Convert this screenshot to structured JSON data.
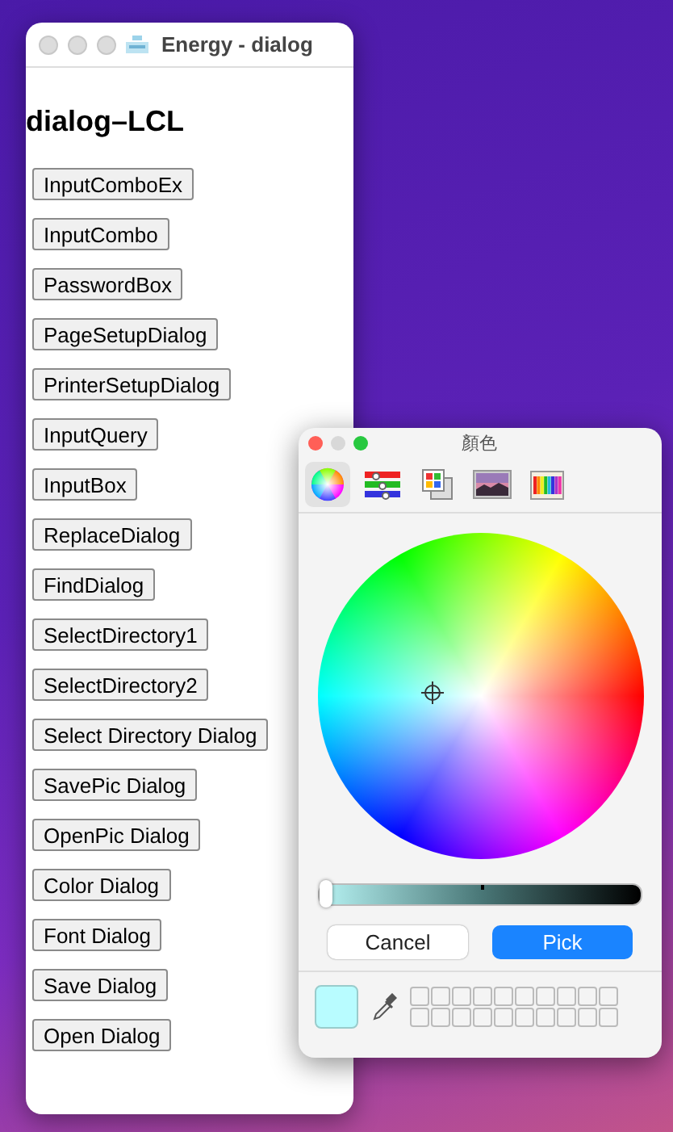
{
  "window": {
    "title": "Energy - dialog"
  },
  "heading": "dialog–LCL",
  "buttons": [
    "InputComboEx",
    "InputCombo",
    "PasswordBox",
    "PageSetupDialog",
    "PrinterSetupDialog",
    "InputQuery",
    "InputBox",
    "ReplaceDialog",
    "FindDialog",
    "SelectDirectory1",
    "SelectDirectory2",
    "Select Directory Dialog",
    "SavePic Dialog",
    "OpenPic Dialog",
    "Color Dialog",
    "Font Dialog",
    "Save Dialog",
    "Open Dialog"
  ],
  "color_panel": {
    "title": "顏色",
    "tabs": [
      {
        "kind": "wheel",
        "selected": true
      },
      {
        "kind": "sliders",
        "selected": false
      },
      {
        "kind": "palettes",
        "selected": false
      },
      {
        "kind": "image",
        "selected": false
      },
      {
        "kind": "pencils",
        "selected": false
      }
    ],
    "brightness": {
      "level": 0
    },
    "buttons": [
      {
        "label": "Cancel",
        "kind": "secondary"
      },
      {
        "label": "Pick",
        "kind": "primary"
      }
    ]
  }
}
